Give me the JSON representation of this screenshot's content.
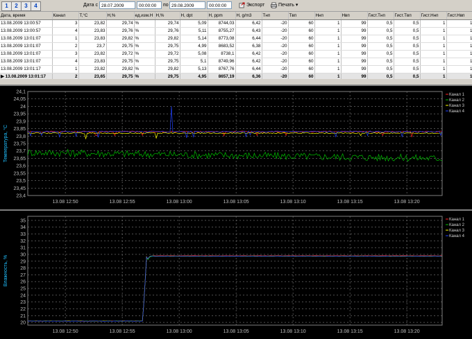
{
  "toolbar": {
    "tabs": [
      "1",
      "2",
      "3",
      "4"
    ],
    "date_from_label": "Дата с",
    "date_from": "28.07.2009",
    "time_from": "00:00:00",
    "to_label": "по",
    "date_to": "29.08.2009",
    "time_to": "00:00:00",
    "export_label": "Экспорт",
    "print_label": "Печать"
  },
  "table": {
    "columns": [
      "Дата, время",
      "Канал",
      "T,°C",
      "H,%",
      "ед.изм.H",
      "H,%",
      "H, dpt",
      "H, ppm",
      "H, g/m3",
      "Tнп",
      "Tвп",
      "Hнп",
      "Hвп",
      "Гист.Tнп",
      "Гист.Tвп",
      "Гист.Hнп",
      "Гист.Hвп"
    ],
    "rows": [
      [
        "13.08.2009 13:00:57",
        "3",
        "23,82",
        "29,74",
        "%",
        "29,74",
        "5,09",
        "8744,03",
        "6,42",
        "-20",
        "60",
        "1",
        "99",
        "0,5",
        "0,5",
        "1",
        "1"
      ],
      [
        "13.08.2009 13:00:57",
        "4",
        "23,83",
        "29,76",
        "%",
        "29,76",
        "5,11",
        "8755,27",
        "6,43",
        "-20",
        "60",
        "1",
        "99",
        "0,5",
        "0,5",
        "1",
        "1"
      ],
      [
        "13.08.2009 13:01:07",
        "1",
        "23,83",
        "29,82",
        "%",
        "29,82",
        "5,14",
        "8773,08",
        "6,44",
        "-20",
        "60",
        "1",
        "99",
        "0,5",
        "0,5",
        "1",
        "1"
      ],
      [
        "13.08.2009 13:01:07",
        "2",
        "23,7",
        "29,75",
        "%",
        "29,75",
        "4,99",
        "8683,52",
        "6,38",
        "-20",
        "60",
        "1",
        "99",
        "0,5",
        "0,5",
        "1",
        "1"
      ],
      [
        "13.08.2009 13:01:07",
        "3",
        "23,82",
        "29,72",
        "%",
        "29,72",
        "5,08",
        "8738,1",
        "6,42",
        "-20",
        "60",
        "1",
        "99",
        "0,5",
        "0,5",
        "1",
        "1"
      ],
      [
        "13.08.2009 13:01:07",
        "4",
        "23,83",
        "29,75",
        "%",
        "29,75",
        "5,1",
        "8749,96",
        "6,42",
        "-20",
        "60",
        "1",
        "99",
        "0,5",
        "0,5",
        "1",
        "1"
      ],
      [
        "13.08.2009 13:01:17",
        "1",
        "23,82",
        "29,82",
        "%",
        "29,82",
        "5,13",
        "8767,76",
        "6,44",
        "-20",
        "60",
        "1",
        "99",
        "0,5",
        "0,5",
        "1",
        "1"
      ],
      [
        "13.08.2009 13:01:17",
        "2",
        "23,65",
        "29,75",
        "%",
        "29,75",
        "4,95",
        "8657,19",
        "6,36",
        "-20",
        "60",
        "1",
        "99",
        "0,5",
        "0,5",
        "1",
        "1"
      ]
    ],
    "selected_row": 7
  },
  "chart_data": [
    {
      "type": "line",
      "ylabel": "Температура, °С",
      "x_ticks": [
        "13.08 12:50",
        "13.08 12:55",
        "13.08 13:00",
        "13.08 13:05",
        "13.08 13:10",
        "13.08 13:15",
        "13.08 13:20"
      ],
      "y_ticks": [
        "23,4",
        "23,45",
        "23,5",
        "23,55",
        "23,6",
        "23,65",
        "23,7",
        "23,75",
        "23,8",
        "23,85",
        "23,9",
        "23,95",
        "24",
        "24,05",
        "24,1"
      ],
      "ylim": [
        23.4,
        24.1
      ],
      "xlim_minutes": [
        -3.3,
        33.1
      ],
      "legend": [
        "Канал 1",
        "Канал 2",
        "Канал 3",
        "Канал 4"
      ],
      "series_colors": [
        "#ff2020",
        "#00c000",
        "#ffff00",
        "#2040ff"
      ],
      "series": [
        {
          "name": "Канал 1",
          "values": [
            23.83,
            23.83
          ]
        },
        {
          "name": "Канал 2",
          "values": [
            23.69,
            23.65
          ]
        },
        {
          "name": "Канал 3",
          "values": [
            23.82,
            23.82
          ]
        },
        {
          "name": "Канал 4",
          "values": [
            23.83,
            23.83
          ],
          "spike": {
            "x_minutes": 9.3,
            "y": 24.0
          }
        }
      ],
      "grid": true,
      "legend_position": "top-right"
    },
    {
      "type": "line",
      "ylabel": "Влажность, %",
      "x_ticks": [
        "13.08 12:50",
        "13.08 12:55",
        "13.08 13:00",
        "13.08 13:05",
        "13.08 13:10",
        "13.08 13:15",
        "13.08 13:20"
      ],
      "y_ticks": [
        "20",
        "21",
        "22",
        "23",
        "24",
        "25",
        "26",
        "27",
        "28",
        "29",
        "30",
        "31",
        "32",
        "33",
        "34",
        "35"
      ],
      "ylim": [
        19.6,
        35.6
      ],
      "xlim_minutes": [
        -3.3,
        33.1
      ],
      "legend": [
        "Канал 1",
        "Канал 2",
        "Канал 3",
        "Канал 4"
      ],
      "series_colors": [
        "#ff2020",
        "#00c000",
        "#ffff00",
        "#2040ff"
      ],
      "series": [
        {
          "name": "Канал 1",
          "start": 20.2,
          "end": 29.8
        },
        {
          "name": "Канал 2",
          "start": 20.2,
          "end": 29.75
        },
        {
          "name": "Канал 3",
          "start": 20.2,
          "end": 29.75
        },
        {
          "name": "Канал 4",
          "start": 20.2,
          "end": 29.75
        }
      ],
      "step_minute": 6.8,
      "grid": true,
      "legend_position": "top-right"
    }
  ]
}
